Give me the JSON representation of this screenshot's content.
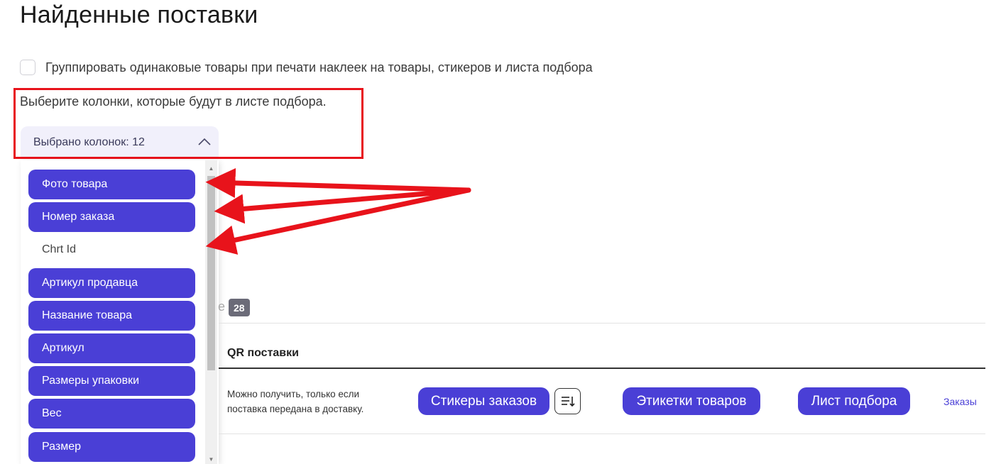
{
  "page": {
    "title": "Найденные поставки"
  },
  "group_option": {
    "label": "Группировать одинаковые товары при печати наклеек на товары, стикеров и листа подбора",
    "checked": false
  },
  "columns": {
    "hint": "Выберите колонки, которые будут в листе подбора.",
    "select_label": "Выбрано колонок: 12",
    "options": [
      {
        "label": "Фото товара",
        "selected": true
      },
      {
        "label": "Номер заказа",
        "selected": true
      },
      {
        "label": "Chrt Id",
        "selected": false
      },
      {
        "label": "Артикул продавца",
        "selected": true
      },
      {
        "label": "Название товара",
        "selected": true
      },
      {
        "label": "Артикул",
        "selected": true
      },
      {
        "label": "Размеры упаковки",
        "selected": true
      },
      {
        "label": "Вес",
        "selected": true
      },
      {
        "label": "Размер",
        "selected": true
      }
    ]
  },
  "tab": {
    "label_tail": "е",
    "count": "28"
  },
  "table": {
    "column_header": "QR поставки",
    "row": {
      "note": "Можно получить, только если поставка передана в доставку.",
      "sticker_button": "Стикеры заказов",
      "labels_button": "Этикетки товаров",
      "picklist_button": "Лист подбора",
      "orders_link": "Заказы"
    }
  },
  "colors": {
    "accent": "#4a3fd6",
    "annotation": "#e8131b",
    "badge": "#6b6b78"
  }
}
